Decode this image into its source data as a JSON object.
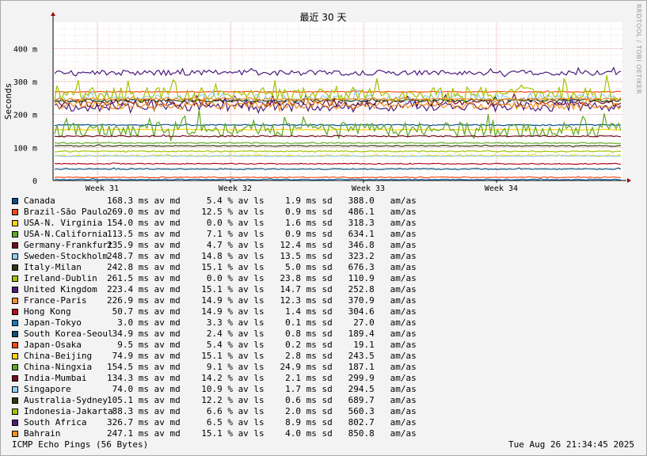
{
  "chart_data": {
    "type": "line",
    "title": "最近 30 天",
    "ylabel": "Seconds",
    "xlabel": "",
    "ylim": [
      0,
      0.48
    ],
    "yticks": [
      {
        "value": 0,
        "label": "0"
      },
      {
        "value": 0.1,
        "label": "100 m"
      },
      {
        "value": 0.2,
        "label": "200 m"
      },
      {
        "value": 0.3,
        "label": "300 m"
      },
      {
        "value": 0.4,
        "label": "400 m"
      }
    ],
    "xticks": [
      "Week 31",
      "Week 32",
      "Week 33",
      "Week 34"
    ],
    "grid": true,
    "watermark": "RRDTOOL / TOBI OETIKER",
    "series": [
      {
        "name": "Canada",
        "color": "#084d8e",
        "median": "168.3 ms",
        "loss": "5.4 %",
        "sd": "1.9 ms",
        "am": "388.0"
      },
      {
        "name": "Brazil-São Paulo",
        "color": "#ff4a12",
        "median": "269.0 ms",
        "loss": "12.5 %",
        "sd": "0.9 ms",
        "am": "486.1"
      },
      {
        "name": "USA-N. Virginia",
        "color": "#ffd500",
        "median": "154.0 ms",
        "loss": "0.0 %",
        "sd": "1.6 ms",
        "am": "318.3"
      },
      {
        "name": "USA-N.California",
        "color": "#5ea926",
        "median": "113.5 ms",
        "loss": "7.1 %",
        "sd": "0.9 ms",
        "am": "634.1"
      },
      {
        "name": "Germany-Frankfurt",
        "color": "#740a1d",
        "median": "235.9 ms",
        "loss": "4.7 %",
        "sd": "12.4 ms",
        "am": "346.8"
      },
      {
        "name": "Sweden-Stockholm",
        "color": "#8fd0f8",
        "median": "248.7 ms",
        "loss": "14.8 %",
        "sd": "13.5 ms",
        "am": "323.2"
      },
      {
        "name": "Italy-Milan",
        "color": "#2a3c0c",
        "median": "242.8 ms",
        "loss": "15.1 %",
        "sd": "5.0 ms",
        "am": "676.3"
      },
      {
        "name": "Ireland-Dublin",
        "color": "#a2c500",
        "median": "261.5 ms",
        "loss": "0.0 %",
        "sd": "23.8 ms",
        "am": "110.9"
      },
      {
        "name": "United Kingdom",
        "color": "#4a1c7c",
        "median": "223.4 ms",
        "loss": "15.1 %",
        "sd": "14.7 ms",
        "am": "252.8"
      },
      {
        "name": "France-Paris",
        "color": "#f6901e",
        "median": "226.9 ms",
        "loss": "14.9 %",
        "sd": "12.3 ms",
        "am": "370.9"
      },
      {
        "name": "Hong Kong",
        "color": "#b50b1c",
        "median": "50.7 ms",
        "loss": "14.9 %",
        "sd": "1.4 ms",
        "am": "304.6"
      },
      {
        "name": "Japan-Tokyo",
        "color": "#1a7ac0",
        "median": "3.0 ms",
        "loss": "3.3 %",
        "sd": "0.1 ms",
        "am": "27.0"
      },
      {
        "name": "South Korea-Seoul",
        "color": "#0c4f7a",
        "median": "34.9 ms",
        "loss": "2.4 %",
        "sd": "0.8 ms",
        "am": "189.4"
      },
      {
        "name": "Japan-Osaka",
        "color": "#ff4a12",
        "median": "9.5 ms",
        "loss": "5.4 %",
        "sd": "0.2 ms",
        "am": "19.1"
      },
      {
        "name": "China-Beijing",
        "color": "#ffd500",
        "median": "74.9 ms",
        "loss": "15.1 %",
        "sd": "2.8 ms",
        "am": "243.5"
      },
      {
        "name": "China-Ningxia",
        "color": "#5ea926",
        "median": "154.5 ms",
        "loss": "9.1 %",
        "sd": "24.9 ms",
        "am": "187.1"
      },
      {
        "name": "India-Mumbai",
        "color": "#740a1d",
        "median": "134.3 ms",
        "loss": "14.2 %",
        "sd": "2.1 ms",
        "am": "299.9"
      },
      {
        "name": "Singapore",
        "color": "#8fd0f8",
        "median": "74.0 ms",
        "loss": "10.9 %",
        "sd": "1.7 ms",
        "am": "294.5"
      },
      {
        "name": "Australia-Sydney",
        "color": "#2a3c0c",
        "median": "105.1 ms",
        "loss": "12.2 %",
        "sd": "0.6 ms",
        "am": "689.7"
      },
      {
        "name": "Indonesia-Jakarta",
        "color": "#a2c500",
        "median": "88.3 ms",
        "loss": "6.6 %",
        "sd": "2.0 ms",
        "am": "560.3"
      },
      {
        "name": "South Africa",
        "color": "#4a1c7c",
        "median": "326.7 ms",
        "loss": "6.5 %",
        "sd": "8.9 ms",
        "am": "802.7"
      },
      {
        "name": "Bahrain",
        "color": "#f6901e",
        "median": "247.1 ms",
        "loss": "15.1 %",
        "sd": "4.0 ms",
        "am": "850.8"
      }
    ]
  },
  "footer": {
    "left": "ICMP Echo Pings (56 Bytes)",
    "right": "Tue Aug 26 21:34:45 2025"
  }
}
